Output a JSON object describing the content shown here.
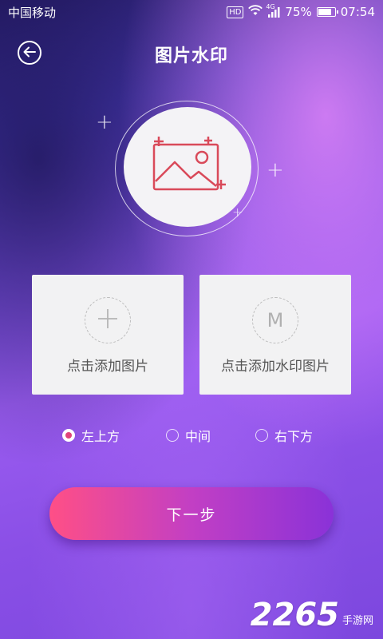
{
  "status_bar": {
    "carrier": "中国移动",
    "hd": "HD",
    "network": "4G",
    "battery": "75%",
    "battery_level": 0.75,
    "time": "07:54"
  },
  "header": {
    "title": "图片水印"
  },
  "cards": {
    "add_image_label": "点击添加图片",
    "add_watermark_label": "点击添加水印图片",
    "watermark_letter": "M"
  },
  "position_options": [
    {
      "label": "左上方",
      "checked": true
    },
    {
      "label": "中间",
      "checked": false
    },
    {
      "label": "右下方",
      "checked": false
    }
  ],
  "next_button": {
    "label": "下一步"
  },
  "watermark": {
    "number": "2265",
    "text": "手游网"
  },
  "colors": {
    "accent": "#e0457b",
    "icon_red": "#d94a5a",
    "button_start": "#ff4f86",
    "button_end": "#8a32d8"
  }
}
